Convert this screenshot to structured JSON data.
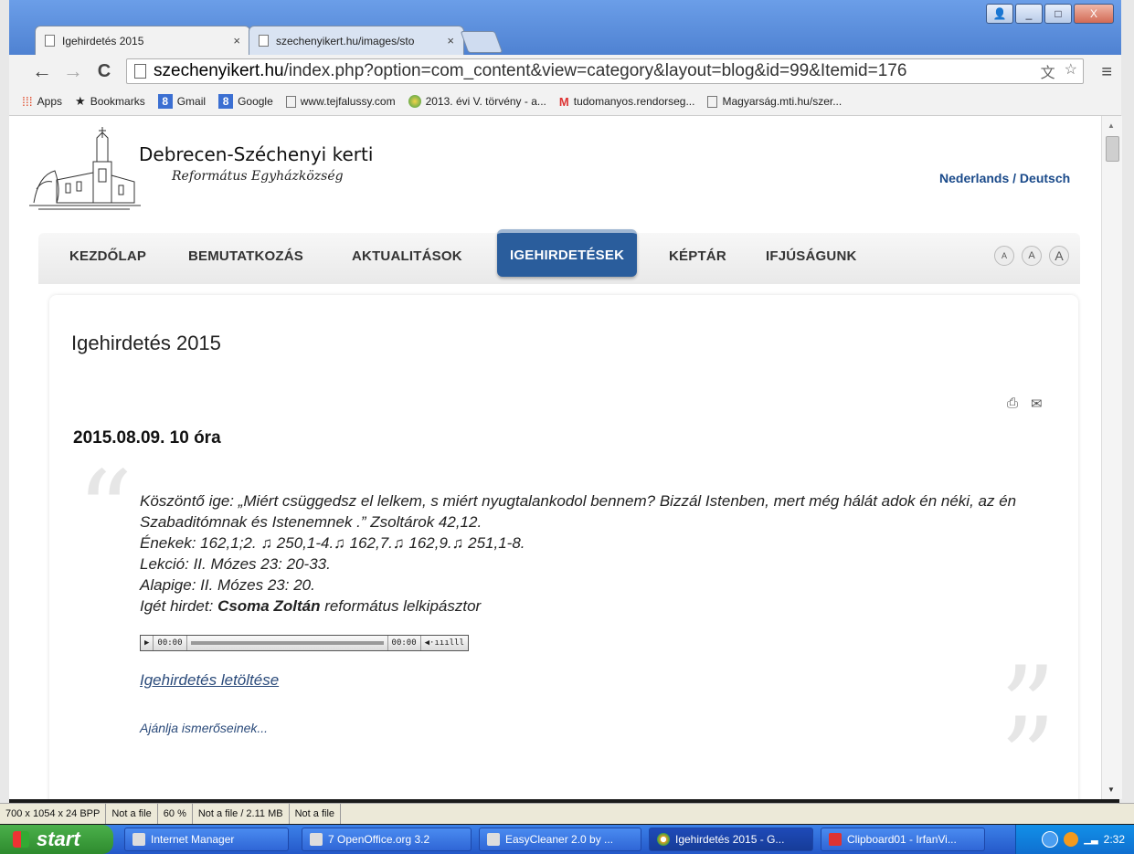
{
  "window": {
    "controls": [
      "_",
      "□",
      "X"
    ]
  },
  "tabs": [
    {
      "label": "Igehirdetés 2015",
      "close": "×"
    },
    {
      "label": "szechenyikert.hu/images/sto",
      "close": "×"
    }
  ],
  "toolbar": {
    "back": "←",
    "forward": "→",
    "reload": "C",
    "url_host": "szechenyikert.hu",
    "url_path": "/index.php?option=com_content&view=category&layout=blog&id=99&Itemid=176",
    "menu": "≡"
  },
  "bookmarks": [
    {
      "label": "Apps",
      "icon": "apps-icon"
    },
    {
      "label": "Bookmarks",
      "icon": "star-icon"
    },
    {
      "label": "Gmail",
      "icon": "8"
    },
    {
      "label": "Google",
      "icon": "8"
    },
    {
      "label": "www.tejfalussy.com",
      "icon": "page-icon"
    },
    {
      "label": "2013. évi V. törvény - a...",
      "icon": "globe-icon"
    },
    {
      "label": "tudomanyos.rendorseg...",
      "icon": "M"
    },
    {
      "label": "Magyarság.mti.hu/szer...",
      "icon": "page-icon"
    }
  ],
  "site": {
    "name": "Debrecen-Széchenyi kerti",
    "subtitle": "Református Egyházközség",
    "languages": "Nederlands / Deutsch"
  },
  "nav": {
    "items": [
      "KEZDŐLAP",
      "BEMUTATKOZÁS",
      "AKTUALITÁSOK",
      "IGEHIRDETÉSEK",
      "KÉPTÁR",
      "IFJÚSÁGUNK"
    ],
    "active_index": 3,
    "font_sizes": [
      "A",
      "A",
      "A"
    ]
  },
  "content": {
    "page_title": "Igehirdetés 2015",
    "article_title": "2015.08.09.  10 óra",
    "quote_lines": [
      "Köszöntő ige: „Miért csüggedsz el lelkem, s miért nyugtalankodol bennem? Bizzál Istenben, mert még hálát adok én néki, az én Szabaditómnak és Istenemnek .” Zsoltárok 42,12.",
      "Énekek: 162,1;2. ♫ 250,1-4.♫ 162,7.♫ 162,9.♫ 251,1-8.",
      "Lekció: II. Mózes 23: 20-33.",
      "Alapige: II. Mózes 23: 20."
    ],
    "preacher_prefix": "Igét hirdet: ",
    "preacher_name": "Csoma Zoltán",
    "preacher_suffix": " református lelkipásztor",
    "player": {
      "play": "▶",
      "current": "00:00",
      "duration": "00:00",
      "volume": "◀·ııılll"
    },
    "download_link": "Igehirdetés letöltése",
    "share_link": "Ajánlja ismerőseinek..."
  },
  "statusbar": [
    "700 x 1054 x 24 BPP",
    "Not a file",
    "60 %",
    "Not a file / 2.11 MB",
    "Not a file"
  ],
  "taskbar": {
    "start": "start",
    "tasks": [
      {
        "label": "Internet Manager",
        "active": false
      },
      {
        "label": "7 OpenOffice.org 3.2",
        "active": false
      },
      {
        "label": "EasyCleaner 2.0 by ...",
        "active": false
      },
      {
        "label": "Igehirdetés 2015 - G...",
        "active": true
      },
      {
        "label": "Clipboard01 - IrfanVi...",
        "active": false
      }
    ],
    "clock": "2:32"
  }
}
